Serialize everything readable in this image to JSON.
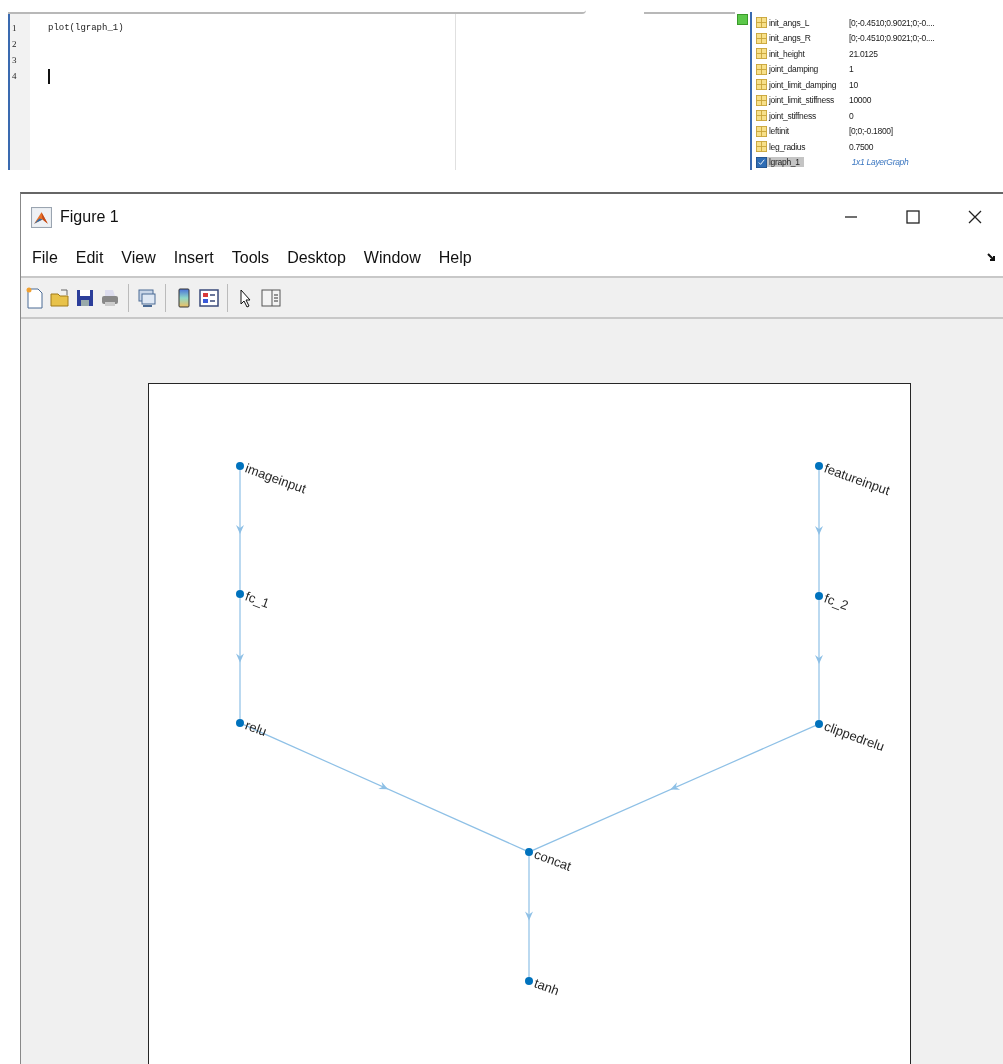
{
  "editor": {
    "lines": [
      {
        "number": "1",
        "code": "plot(lgraph_1)",
        "cursor": false
      },
      {
        "number": "2",
        "cursor": false
      },
      {
        "number": "3",
        "cursor": false
      },
      {
        "number": "4",
        "cursor": true
      }
    ]
  },
  "workspace": {
    "rows": [
      {
        "kind": "matrix",
        "name": "init_angs_L",
        "value": "[0;-0.4510;0.9021;0;-0....",
        "selected": false
      },
      {
        "kind": "matrix",
        "name": "init_angs_R",
        "value": "[0;-0.4510;0.9021;0;-0....",
        "selected": false
      },
      {
        "kind": "matrix",
        "name": "init_height",
        "value": "21.0125",
        "selected": false
      },
      {
        "kind": "matrix",
        "name": "joint_damping",
        "value": "1",
        "selected": false
      },
      {
        "kind": "matrix",
        "name": "joint_limit_damping",
        "value": "10",
        "selected": false
      },
      {
        "kind": "matrix",
        "name": "joint_limit_stiffness",
        "value": "10000",
        "selected": false
      },
      {
        "kind": "matrix",
        "name": "joint_stiffness",
        "value": "0",
        "selected": false
      },
      {
        "kind": "matrix",
        "name": "leftinit",
        "value": "[0;0;-0.1800]",
        "selected": false
      },
      {
        "kind": "matrix",
        "name": "leg_radius",
        "value": "0.7500",
        "selected": false
      },
      {
        "kind": "object",
        "name": "lgraph_1",
        "value": "1x1 LayerGraph",
        "selected": true
      }
    ]
  },
  "figure": {
    "title": "Figure 1",
    "menu": [
      "File",
      "Edit",
      "View",
      "Insert",
      "Tools",
      "Desktop",
      "Window",
      "Help"
    ],
    "graph": {
      "nodes": [
        {
          "label": "imageinput"
        },
        {
          "label": "fc_1"
        },
        {
          "label": "relu"
        },
        {
          "label": "featureinput"
        },
        {
          "label": "fc_2"
        },
        {
          "label": "clippedrelu"
        },
        {
          "label": "concat"
        },
        {
          "label": "tanh"
        }
      ]
    }
  }
}
